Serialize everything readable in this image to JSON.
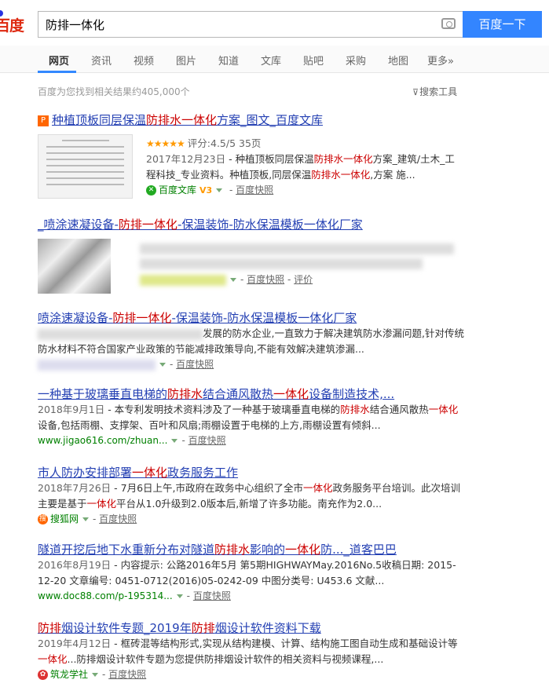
{
  "logo": "百度",
  "search": {
    "value": "防排一体化",
    "button": "百度一下"
  },
  "tabs": [
    "网页",
    "资讯",
    "视频",
    "图片",
    "知道",
    "文库",
    "贴吧",
    "采购",
    "地图",
    "更多»"
  ],
  "result_count": "百度为您找到相关结果约405,000个",
  "search_tools": "搜索工具",
  "results": [
    {
      "title_pre": "种植顶板同层保温",
      "title_em": "防排水一体化",
      "title_post": "方案_图文_百度文库",
      "rating": "★★★★★",
      "rating_text": "评分:4.5/5 35页",
      "date": "2017年12月23日",
      "abs1": " - 种植顶板同层保温",
      "abs_em1": "防排水一体化",
      "abs2": "方案_建筑/土木_工程科技_专业资料。种植顶板,同层保温",
      "abs_em2": "防排水一体化",
      "abs3": ",方案 施...",
      "source": "百度文库",
      "v3": "V3",
      "snap": "百度快照"
    },
    {
      "title_pre": "_喷涂速凝设备-",
      "title_em": "防排一体化",
      "title_post": "-保温装饰-防水保温模板一体化厂家",
      "snap": "百度快照",
      "extra": "评价"
    },
    {
      "title_pre": "喷涂速凝设备-",
      "title_em": "防排一体化",
      "title_post": "-保温装饰-防水保温模板一体化厂家",
      "abs1": "发展的防水企业,一直致力于解决建筑防水渗漏问题,针对传统防水材料不符合国家产业政策的节能减排政策导向,不能有效解决建筑渗漏...",
      "snap": "百度快照"
    },
    {
      "title_pre": "一种基于玻璃垂直电梯的",
      "title_em": "防排水",
      "title_mid": "结合通风散热",
      "title_em2": "一体化",
      "title_post": "设备制造技术,...",
      "date": "2018年9月1日",
      "abs1": " - 本专利发明技术资料涉及了一种基于玻璃垂直电梯的",
      "abs_em1": "防排水",
      "abs2": "结合通风散热",
      "abs_em2": "一体化",
      "abs3": "设备,包括雨棚、支撑架、百叶和风扇;雨棚设置于电梯的上方,雨棚设置有倾斜...",
      "url": "www.jigao616.com/zhuan...",
      "snap": "百度快照"
    },
    {
      "title_pre": "市人防办安排部署",
      "title_em": "一体化",
      "title_post": "政务服务工作",
      "date": "2018年7月26日",
      "abs1": " - 7月6日上午,市政府在政务中心组织了全市",
      "abs_em1": "一体化",
      "abs2": "政务服务平台培训。此次培训主要是基于",
      "abs_em2": "一体化",
      "abs3": "平台从1.0升级到2.0版本后,新增了许多功能。南充作为2.0...",
      "source": "搜狐网",
      "snap": "百度快照"
    },
    {
      "title_pre": "隧道开挖后地下水重新分布对隧道",
      "title_em": "防排水",
      "title_mid": "影响的",
      "title_em2": "一体化",
      "title_post": "防..._道客巴巴",
      "date": "2016年8月19日",
      "abs1": " - 内容提示: 公路2016年5月 第5期HIGHWAYMay.2016No.5收稿日期: 2015-12-20 文章编号: 0451-0712(2016)05-0242-09 中图分类号: U453.6 文献...",
      "url": "www.doc88.com/p-195314...",
      "snap": "百度快照"
    },
    {
      "title_em": "防排",
      "title_pre2": "烟设计软件专题_2019年",
      "title_em2": "防排",
      "title_post": "烟设计软件资料下载",
      "date": "2019年4月12日",
      "abs1": " - 框砖混等结构形式,实现从结构建模、计算、结构施工图自动生成和基础设计等",
      "abs_em1": "一体化",
      "abs2": "...防排烟设计软件专题为您提供防排烟设计软件的相关资料与视频课程,...",
      "source": "筑龙学社",
      "snap": "百度快照"
    }
  ]
}
